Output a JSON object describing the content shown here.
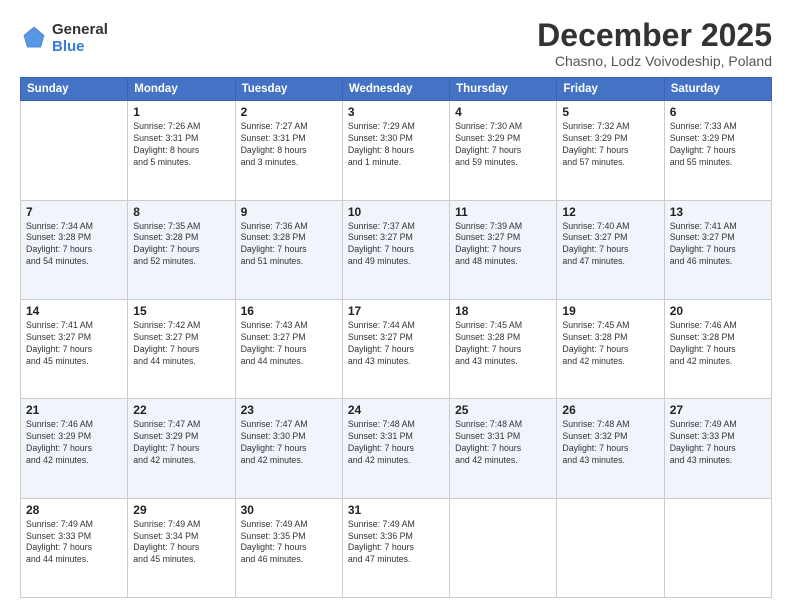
{
  "logo": {
    "general": "General",
    "blue": "Blue"
  },
  "header": {
    "month": "December 2025",
    "location": "Chasno, Lodz Voivodeship, Poland"
  },
  "days_of_week": [
    "Sunday",
    "Monday",
    "Tuesday",
    "Wednesday",
    "Thursday",
    "Friday",
    "Saturday"
  ],
  "weeks": [
    [
      {
        "day": "",
        "info": ""
      },
      {
        "day": "1",
        "info": "Sunrise: 7:26 AM\nSunset: 3:31 PM\nDaylight: 8 hours\nand 5 minutes."
      },
      {
        "day": "2",
        "info": "Sunrise: 7:27 AM\nSunset: 3:31 PM\nDaylight: 8 hours\nand 3 minutes."
      },
      {
        "day": "3",
        "info": "Sunrise: 7:29 AM\nSunset: 3:30 PM\nDaylight: 8 hours\nand 1 minute."
      },
      {
        "day": "4",
        "info": "Sunrise: 7:30 AM\nSunset: 3:29 PM\nDaylight: 7 hours\nand 59 minutes."
      },
      {
        "day": "5",
        "info": "Sunrise: 7:32 AM\nSunset: 3:29 PM\nDaylight: 7 hours\nand 57 minutes."
      },
      {
        "day": "6",
        "info": "Sunrise: 7:33 AM\nSunset: 3:29 PM\nDaylight: 7 hours\nand 55 minutes."
      }
    ],
    [
      {
        "day": "7",
        "info": "Sunrise: 7:34 AM\nSunset: 3:28 PM\nDaylight: 7 hours\nand 54 minutes."
      },
      {
        "day": "8",
        "info": "Sunrise: 7:35 AM\nSunset: 3:28 PM\nDaylight: 7 hours\nand 52 minutes."
      },
      {
        "day": "9",
        "info": "Sunrise: 7:36 AM\nSunset: 3:28 PM\nDaylight: 7 hours\nand 51 minutes."
      },
      {
        "day": "10",
        "info": "Sunrise: 7:37 AM\nSunset: 3:27 PM\nDaylight: 7 hours\nand 49 minutes."
      },
      {
        "day": "11",
        "info": "Sunrise: 7:39 AM\nSunset: 3:27 PM\nDaylight: 7 hours\nand 48 minutes."
      },
      {
        "day": "12",
        "info": "Sunrise: 7:40 AM\nSunset: 3:27 PM\nDaylight: 7 hours\nand 47 minutes."
      },
      {
        "day": "13",
        "info": "Sunrise: 7:41 AM\nSunset: 3:27 PM\nDaylight: 7 hours\nand 46 minutes."
      }
    ],
    [
      {
        "day": "14",
        "info": "Sunrise: 7:41 AM\nSunset: 3:27 PM\nDaylight: 7 hours\nand 45 minutes."
      },
      {
        "day": "15",
        "info": "Sunrise: 7:42 AM\nSunset: 3:27 PM\nDaylight: 7 hours\nand 44 minutes."
      },
      {
        "day": "16",
        "info": "Sunrise: 7:43 AM\nSunset: 3:27 PM\nDaylight: 7 hours\nand 44 minutes."
      },
      {
        "day": "17",
        "info": "Sunrise: 7:44 AM\nSunset: 3:27 PM\nDaylight: 7 hours\nand 43 minutes."
      },
      {
        "day": "18",
        "info": "Sunrise: 7:45 AM\nSunset: 3:28 PM\nDaylight: 7 hours\nand 43 minutes."
      },
      {
        "day": "19",
        "info": "Sunrise: 7:45 AM\nSunset: 3:28 PM\nDaylight: 7 hours\nand 42 minutes."
      },
      {
        "day": "20",
        "info": "Sunrise: 7:46 AM\nSunset: 3:28 PM\nDaylight: 7 hours\nand 42 minutes."
      }
    ],
    [
      {
        "day": "21",
        "info": "Sunrise: 7:46 AM\nSunset: 3:29 PM\nDaylight: 7 hours\nand 42 minutes."
      },
      {
        "day": "22",
        "info": "Sunrise: 7:47 AM\nSunset: 3:29 PM\nDaylight: 7 hours\nand 42 minutes."
      },
      {
        "day": "23",
        "info": "Sunrise: 7:47 AM\nSunset: 3:30 PM\nDaylight: 7 hours\nand 42 minutes."
      },
      {
        "day": "24",
        "info": "Sunrise: 7:48 AM\nSunset: 3:31 PM\nDaylight: 7 hours\nand 42 minutes."
      },
      {
        "day": "25",
        "info": "Sunrise: 7:48 AM\nSunset: 3:31 PM\nDaylight: 7 hours\nand 42 minutes."
      },
      {
        "day": "26",
        "info": "Sunrise: 7:48 AM\nSunset: 3:32 PM\nDaylight: 7 hours\nand 43 minutes."
      },
      {
        "day": "27",
        "info": "Sunrise: 7:49 AM\nSunset: 3:33 PM\nDaylight: 7 hours\nand 43 minutes."
      }
    ],
    [
      {
        "day": "28",
        "info": "Sunrise: 7:49 AM\nSunset: 3:33 PM\nDaylight: 7 hours\nand 44 minutes."
      },
      {
        "day": "29",
        "info": "Sunrise: 7:49 AM\nSunset: 3:34 PM\nDaylight: 7 hours\nand 45 minutes."
      },
      {
        "day": "30",
        "info": "Sunrise: 7:49 AM\nSunset: 3:35 PM\nDaylight: 7 hours\nand 46 minutes."
      },
      {
        "day": "31",
        "info": "Sunrise: 7:49 AM\nSunset: 3:36 PM\nDaylight: 7 hours\nand 47 minutes."
      },
      {
        "day": "",
        "info": ""
      },
      {
        "day": "",
        "info": ""
      },
      {
        "day": "",
        "info": ""
      }
    ]
  ]
}
